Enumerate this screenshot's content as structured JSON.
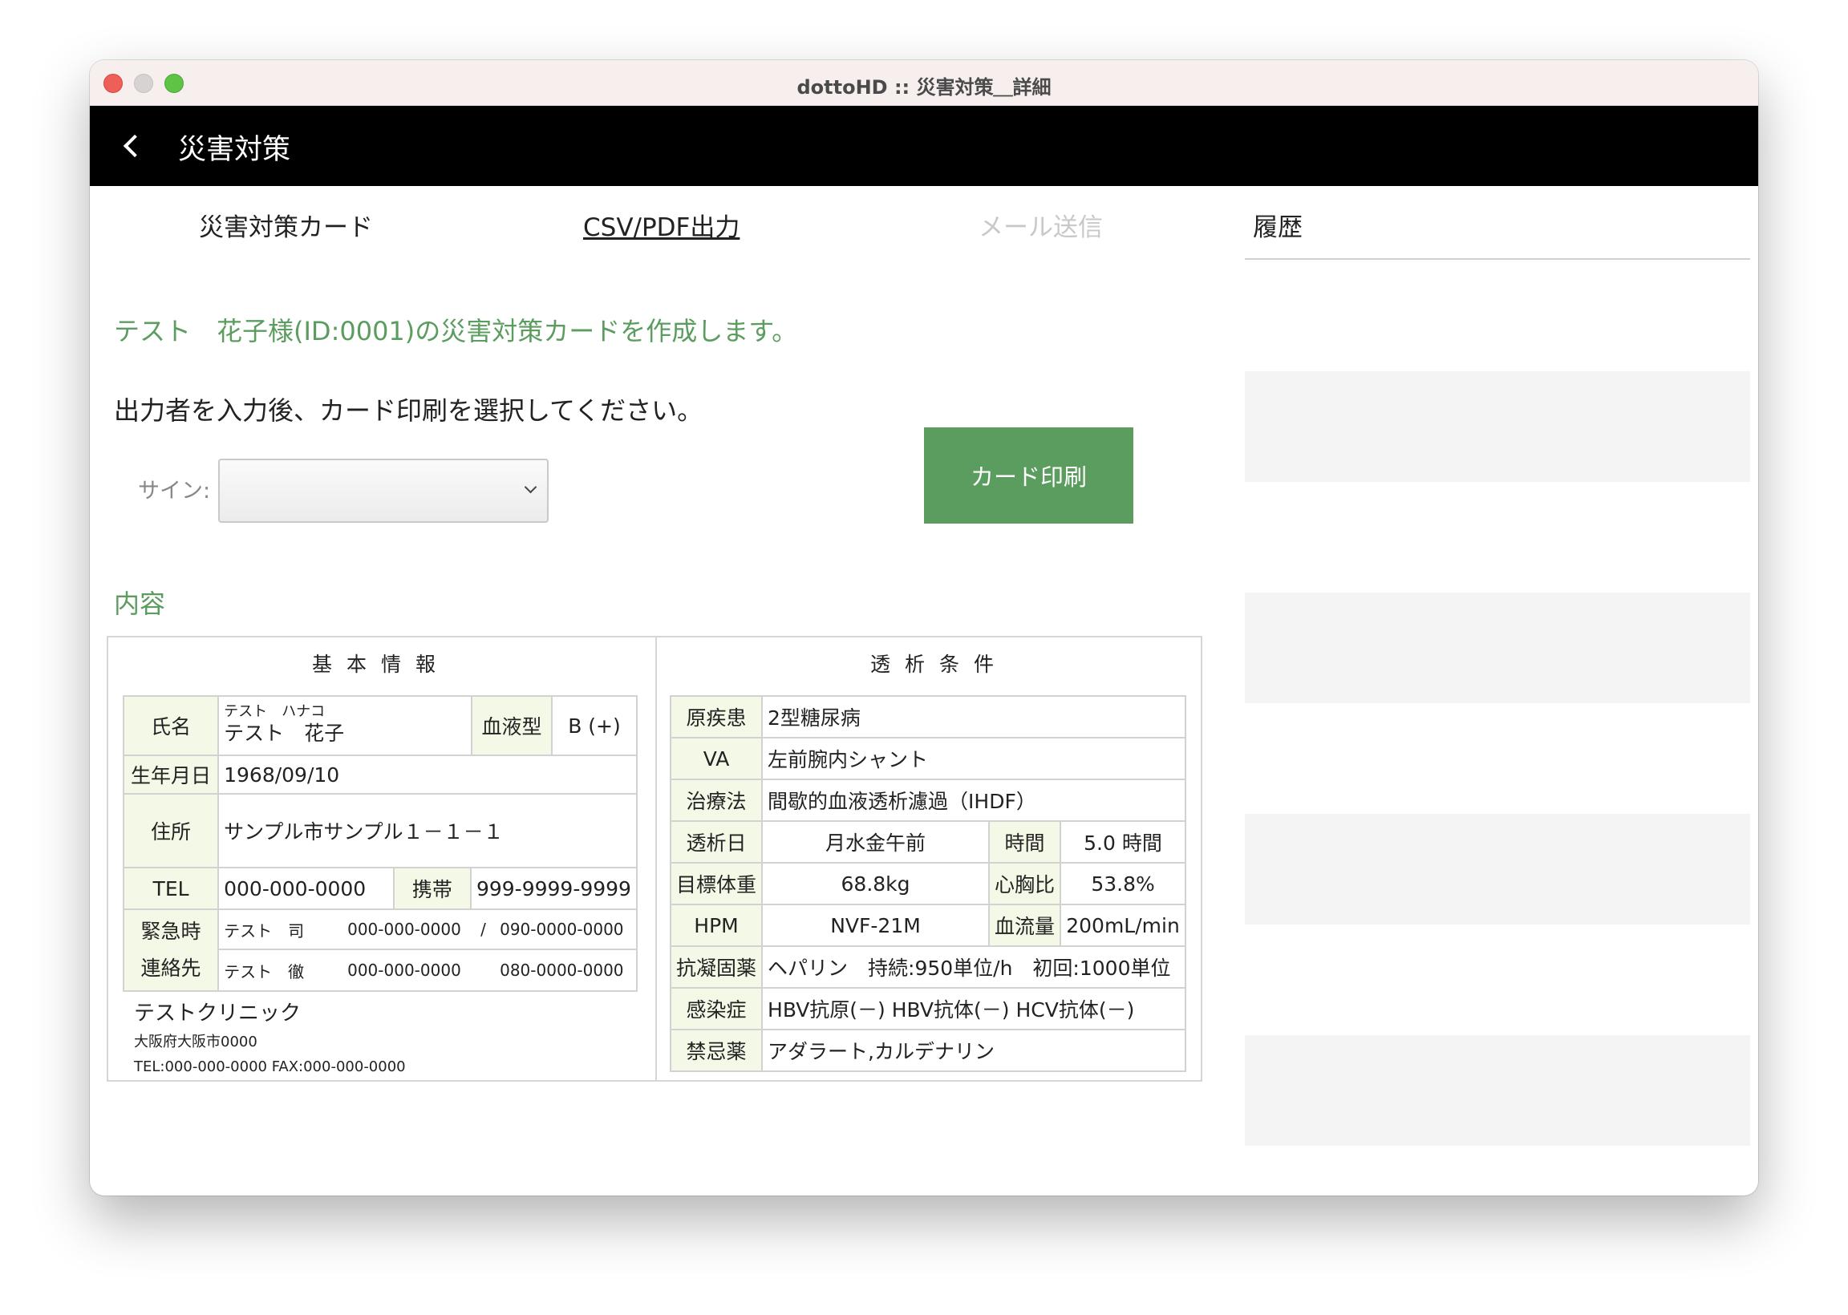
{
  "window": {
    "title": "dottoHD :: 災害対策＿詳細"
  },
  "appbar": {
    "title": "災害対策"
  },
  "tabs": {
    "card": "災害対策カード",
    "csv": "CSV/PDF出力",
    "mail": "メール送信"
  },
  "history": {
    "title": "履歴"
  },
  "intro": "テスト　花子様(ID:0001)の災害対策カードを作成します。",
  "instruction": "出力者を入力後、カード印刷を選択してください。",
  "sign": {
    "label": "サイン:",
    "value": ""
  },
  "print_button": "カード印刷",
  "content_title": "内容",
  "card": {
    "basic_header": "基本情報",
    "dialysis_header": "透析条件",
    "basic": {
      "name_label": "氏名",
      "name_kana": "テスト　ハナコ",
      "name": "テスト　花子",
      "blood_label": "血液型",
      "blood": "B (+)",
      "birth_label": "生年月日",
      "birth": "1968/09/10",
      "address_label": "住所",
      "address": "サンプル市サンプル１－１－１",
      "tel_label": "TEL",
      "tel": "000-000-0000",
      "mobile_label": "携帯",
      "mobile": "999-9999-9999",
      "emergency_label_1": "緊急時",
      "emergency_label_2": "連絡先",
      "contacts": [
        {
          "name": "テスト　司",
          "tel": "000-000-0000",
          "sep": "/",
          "mobile": "090-0000-0000"
        },
        {
          "name": "テスト　徹",
          "tel": "000-000-0000",
          "sep": "",
          "mobile": "080-0000-0000"
        }
      ]
    },
    "clinic": {
      "name": "テストクリニック",
      "address": "大阪府大阪市0000",
      "tel": "TEL:000-000-0000 FAX:000-000-0000"
    },
    "dialysis": {
      "disease_label": "原疾患",
      "disease": "2型糖尿病",
      "va_label": "VA",
      "va": "左前腕内シャント",
      "therapy_label": "治療法",
      "therapy": "間歇的血液透析濾過（IHDF）",
      "days_label": "透析日",
      "days": "月水金午前",
      "time_label": "時間",
      "time": "5.0 時間",
      "dry_weight_label": "目標体重",
      "dry_weight": "68.8kg",
      "ctr_label": "心胸比",
      "ctr": "53.8%",
      "hpm_label": "HPM",
      "hpm": "NVF-21M",
      "flow_label": "血流量",
      "flow": "200mL/min",
      "anticoag_label": "抗凝固薬",
      "anticoag": "ヘパリン　持続:950単位/h　初回:1000単位",
      "infection_label": "感染症",
      "infection": "HBV抗原(－) HBV抗体(－) HCV抗体(－)",
      "contra_label": "禁忌薬",
      "contra": "アダラート,カルデナリン"
    }
  }
}
